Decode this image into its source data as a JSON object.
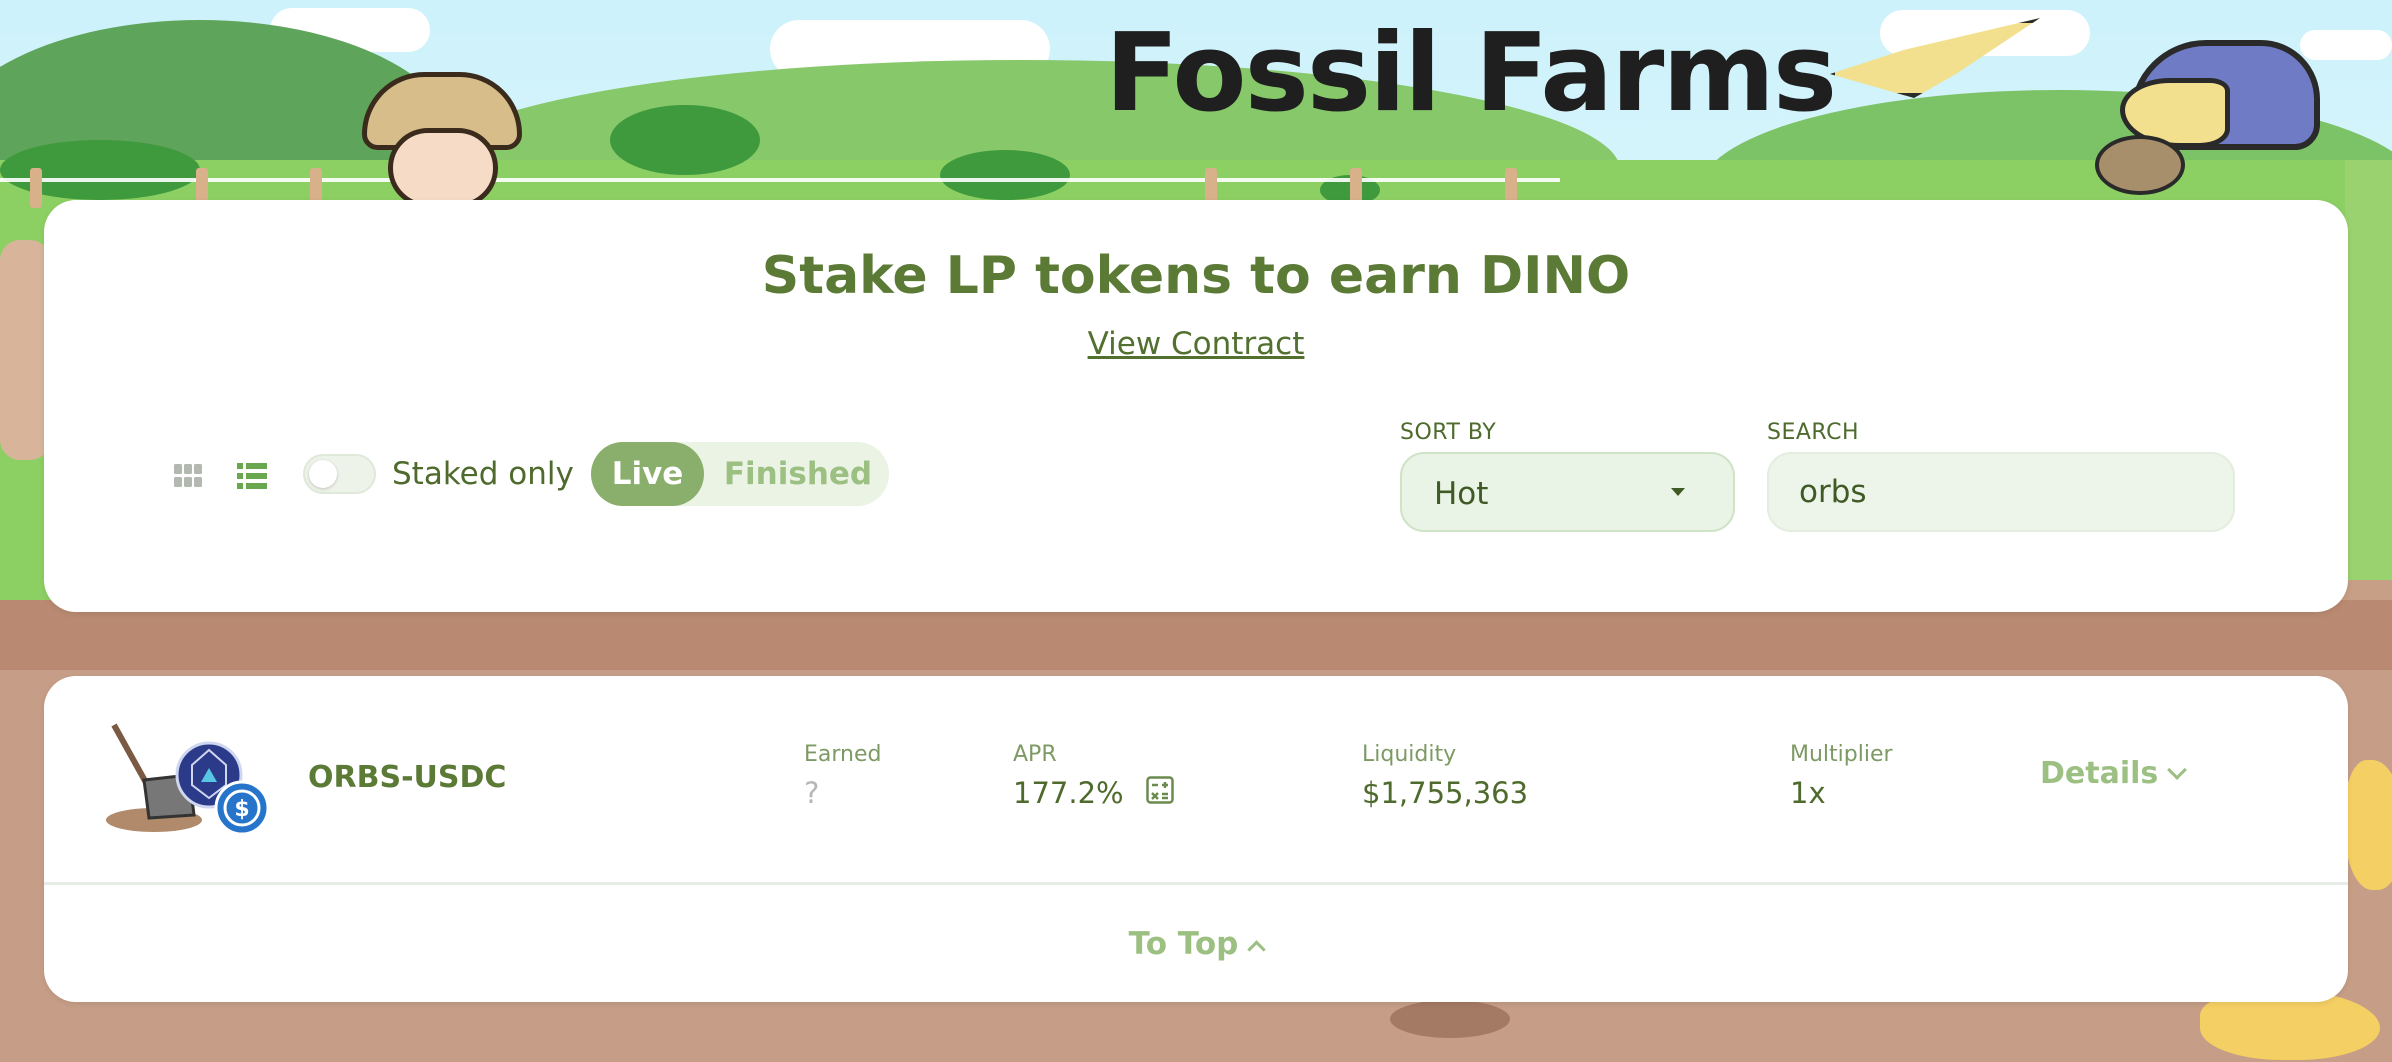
{
  "brand": {
    "title": "Fossil Farms"
  },
  "header": {
    "heading": "Stake LP tokens to earn DINO",
    "view_contract": "View Contract"
  },
  "controls": {
    "staked_only_label": "Staked only",
    "staked_only_on": false,
    "tabs": [
      {
        "label": "Live",
        "active": true
      },
      {
        "label": "Finished",
        "active": false
      }
    ],
    "sort_by_label": "SORT BY",
    "sort_value": "Hot",
    "search_label": "SEARCH",
    "search_value": "orbs"
  },
  "farms": [
    {
      "pair": "ORBS-USDC",
      "earned_label": "Earned",
      "earned_value": "?",
      "apr_label": "APR",
      "apr_value": "177.2%",
      "liquidity_label": "Liquidity",
      "liquidity_value": "$1,755,363",
      "multiplier_label": "Multiplier",
      "multiplier_value": "1x",
      "details_label": "Details"
    }
  ],
  "footer": {
    "to_top": "To Top"
  },
  "colors": {
    "primary_green": "#5b7a35",
    "light_green": "#9cbf82",
    "active_tab": "#8aaf6c",
    "dirt": "#c69e87"
  },
  "icons": [
    "grid-view-icon",
    "list-view-icon",
    "calculator-icon",
    "chevron-down-icon",
    "chevron-up-icon",
    "orbs-token-icon",
    "usdc-token-icon",
    "caret-down-icon"
  ]
}
